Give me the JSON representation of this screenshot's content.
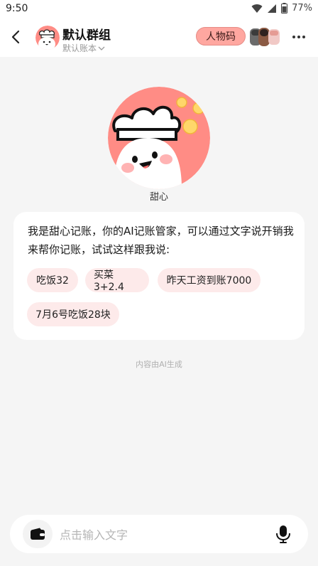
{
  "status_bar": {
    "time": "9:50",
    "battery": "77%"
  },
  "header": {
    "title": "默认群组",
    "subtitle": "默认账本",
    "character_button": "人物码"
  },
  "assistant": {
    "name": "甜心",
    "intro": "我是甜心记账，你的AI记账管家，可以通过文字说开销我来帮你记账，试试这样跟我说:",
    "suggestions": [
      "吃饭32",
      "买菜3+2.4",
      "昨天工资到账7000",
      "7月6号吃饭28块"
    ]
  },
  "ai_note": "内容由AI生成",
  "input": {
    "placeholder": "点击输入文字"
  },
  "colors": {
    "accent": "#ffa7a0",
    "chip_bg": "#fdeaea",
    "avatar_bg": "#ff8c85"
  }
}
